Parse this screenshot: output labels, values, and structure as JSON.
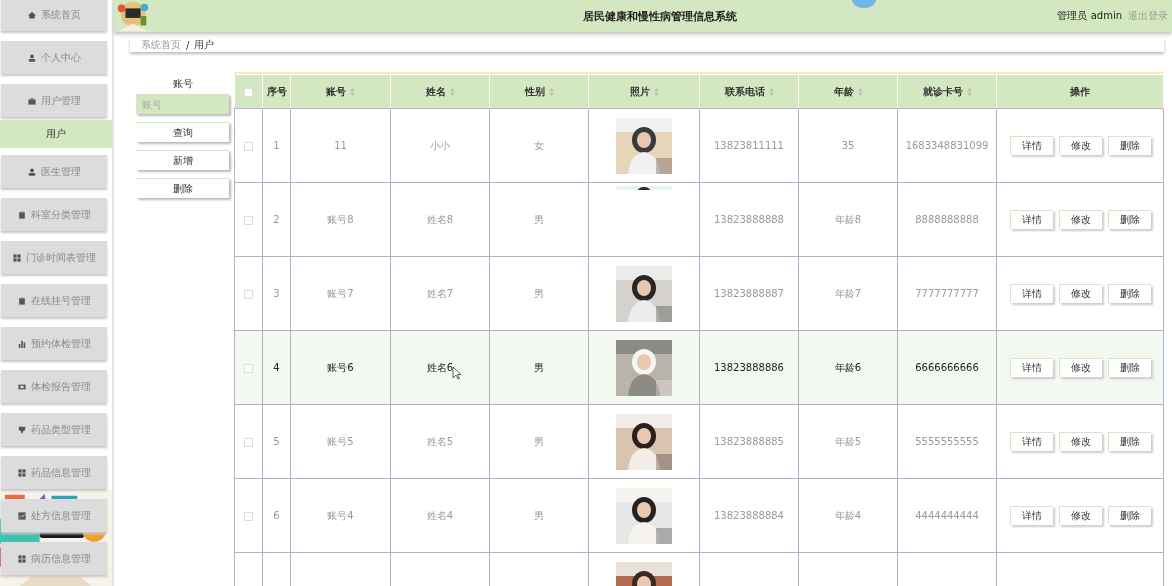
{
  "sidebar": {
    "items": [
      {
        "label": "系统首页",
        "selected": false
      },
      {
        "label": "个人中心",
        "selected": false
      },
      {
        "label": "用户管理",
        "selected": false,
        "children": [
          {
            "label": "用户",
            "selected": true
          }
        ]
      },
      {
        "label": "医生管理",
        "selected": false
      },
      {
        "label": "科室分类管理",
        "selected": false
      },
      {
        "label": "门诊时间表管理",
        "selected": false
      },
      {
        "label": "在线挂号管理",
        "selected": false
      },
      {
        "label": "预约体检管理",
        "selected": false
      },
      {
        "label": "体检报告管理",
        "selected": false
      },
      {
        "label": "药品类型管理",
        "selected": false
      },
      {
        "label": "药品信息管理",
        "selected": false
      },
      {
        "label": "处方信息管理",
        "selected": false
      },
      {
        "label": "病历信息管理",
        "selected": false
      }
    ]
  },
  "header": {
    "title": "居民健康和慢性病管理信息系统",
    "role": "管理员 admin",
    "logout": "退出登录"
  },
  "breadcrumb": [
    "系统首页",
    "/",
    "用户"
  ],
  "search": {
    "label": "账号",
    "placeholder": "账号",
    "buttons": [
      "查询",
      "新增",
      "删除"
    ]
  },
  "table": {
    "columns": [
      {
        "kind": "checkbox",
        "checked": false
      },
      {
        "label": "序号",
        "sortable": false
      },
      {
        "label": "账号",
        "sortable": true
      },
      {
        "label": "姓名",
        "sortable": true
      },
      {
        "label": "性别",
        "sortable": true
      },
      {
        "label": "照片",
        "sortable": true
      },
      {
        "label": "联系电话",
        "sortable": true
      },
      {
        "label": "年龄",
        "sortable": true
      },
      {
        "label": "就诊卡号",
        "sortable": true
      },
      {
        "label": "操作",
        "sortable": false
      }
    ],
    "rows": [
      {
        "hovered": false,
        "cells": [
          {
            "kind": "checkbox",
            "checked": false
          },
          "1",
          "11",
          "小小",
          "女",
          {
            "kind": "picture",
            "cropped": false
          },
          "13823811111",
          "35",
          "1683348831099",
          {
            "kind": "actions",
            "buttons": [
              "详情",
              "修改",
              "删除"
            ]
          }
        ]
      },
      {
        "hovered": false,
        "cells": [
          {
            "kind": "checkbox",
            "checked": false
          },
          "2",
          "账号8",
          "姓名8",
          "男",
          {
            "kind": "picture",
            "cropped": true
          },
          "13823888888",
          "年龄8",
          "8888888888",
          {
            "kind": "actions",
            "buttons": [
              "详情",
              "修改",
              "删除"
            ]
          }
        ]
      },
      {
        "hovered": false,
        "cells": [
          {
            "kind": "checkbox",
            "checked": false
          },
          "3",
          "账号7",
          "姓名7",
          "男",
          {
            "kind": "picture",
            "cropped": false
          },
          "13823888887",
          "年龄7",
          "7777777777",
          {
            "kind": "actions",
            "buttons": [
              "详情",
              "修改",
              "删除"
            ]
          }
        ]
      },
      {
        "hovered": true,
        "cells": [
          {
            "kind": "checkbox",
            "checked": false
          },
          "4",
          "账号6",
          "姓名6",
          "男",
          {
            "kind": "picture",
            "cropped": false
          },
          "13823888886",
          "年龄6",
          "6666666666",
          {
            "kind": "actions",
            "buttons": [
              "详情",
              "修改",
              "删除"
            ]
          }
        ]
      },
      {
        "hovered": false,
        "cells": [
          {
            "kind": "checkbox",
            "checked": false
          },
          "5",
          "账号5",
          "姓名5",
          "男",
          {
            "kind": "picture",
            "cropped": false
          },
          "13823888885",
          "年龄5",
          "5555555555",
          {
            "kind": "actions",
            "buttons": [
              "详情",
              "修改",
              "删除"
            ]
          }
        ]
      },
      {
        "hovered": false,
        "cells": [
          {
            "kind": "checkbox",
            "checked": false
          },
          "6",
          "账号4",
          "姓名4",
          "男",
          {
            "kind": "picture",
            "cropped": false
          },
          "13823888884",
          "年龄4",
          "4444444444",
          {
            "kind": "actions",
            "buttons": [
              "详情",
              "修改",
              "删除"
            ]
          }
        ]
      },
      {
        "hovered": false,
        "cells": [
          null,
          null,
          null,
          null,
          null,
          {
            "kind": "picture",
            "cropped": false
          },
          null,
          null,
          null,
          null
        ]
      }
    ]
  }
}
